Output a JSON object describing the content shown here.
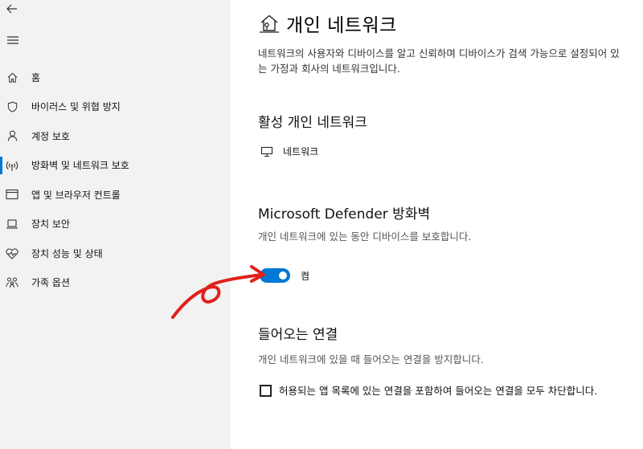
{
  "sidebar": {
    "items": [
      {
        "label": "홈",
        "icon": "home-icon"
      },
      {
        "label": "바이러스 및 위협 방지",
        "icon": "shield-icon"
      },
      {
        "label": "계정 보호",
        "icon": "person-icon"
      },
      {
        "label": "방화벽 및 네트워크 보호",
        "icon": "wifi-signal-icon",
        "active": true
      },
      {
        "label": "앱 및 브라우저 컨트롤",
        "icon": "browser-window-icon"
      },
      {
        "label": "장치 보안",
        "icon": "laptop-icon"
      },
      {
        "label": "장치 성능 및 상태",
        "icon": "heart-pulse-icon"
      },
      {
        "label": "가족 옵션",
        "icon": "family-icon"
      }
    ]
  },
  "main": {
    "title": "개인 네트워크",
    "description": "네트워크의 사용자와 디바이스를 알고 신뢰하며 디바이스가 검색 가능으로 설정되어 있는 가정과 회사의 네트워크입니다.",
    "active_section": {
      "title": "활성 개인 네트워크",
      "network_name": "네트워크"
    },
    "firewall_section": {
      "title": "Microsoft Defender 방화벽",
      "description": "개인 네트워크에 있는 동안 디바이스를 보호합니다.",
      "toggle_state_label": "켬",
      "toggle_on": true
    },
    "incoming_section": {
      "title": "들어오는 연결",
      "description": "개인 네트워크에 있을 때 들어오는 연결을 방지합니다.",
      "checkbox_label": "허용되는 앱 목록에 있는 연결을 포함하여 들어오는 연결을 모두 차단합니다.",
      "checkbox_checked": false
    }
  },
  "colors": {
    "accent": "#0078d4",
    "sidebar_bg": "#f2f2f2",
    "annotation": "#e0201a"
  }
}
